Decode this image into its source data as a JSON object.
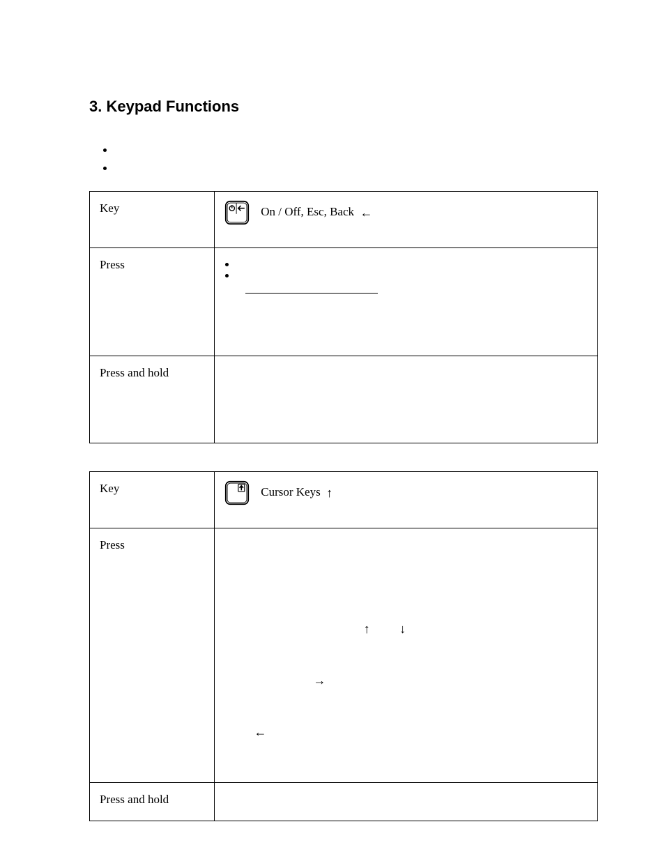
{
  "heading": "3. Keypad Functions",
  "bullets": [
    "",
    ""
  ],
  "table1": {
    "key_label": "Key",
    "press_label": "Press",
    "hold_label": "Press and hold",
    "key_value": "On / Off, Esc, Back  ←",
    "press_items": [
      "",
      ""
    ],
    "underline_text": "",
    "press_rest": "",
    "hold_value": ""
  },
  "table2": {
    "key_label": "Key",
    "press_label": "Press",
    "hold_label": "Press and hold",
    "key_value": "Cursor Keys  ↑",
    "press_line1": "                                               ↑          ↓",
    "press_line2": "                              →",
    "press_line3": "          ←",
    "hold_value": ""
  }
}
